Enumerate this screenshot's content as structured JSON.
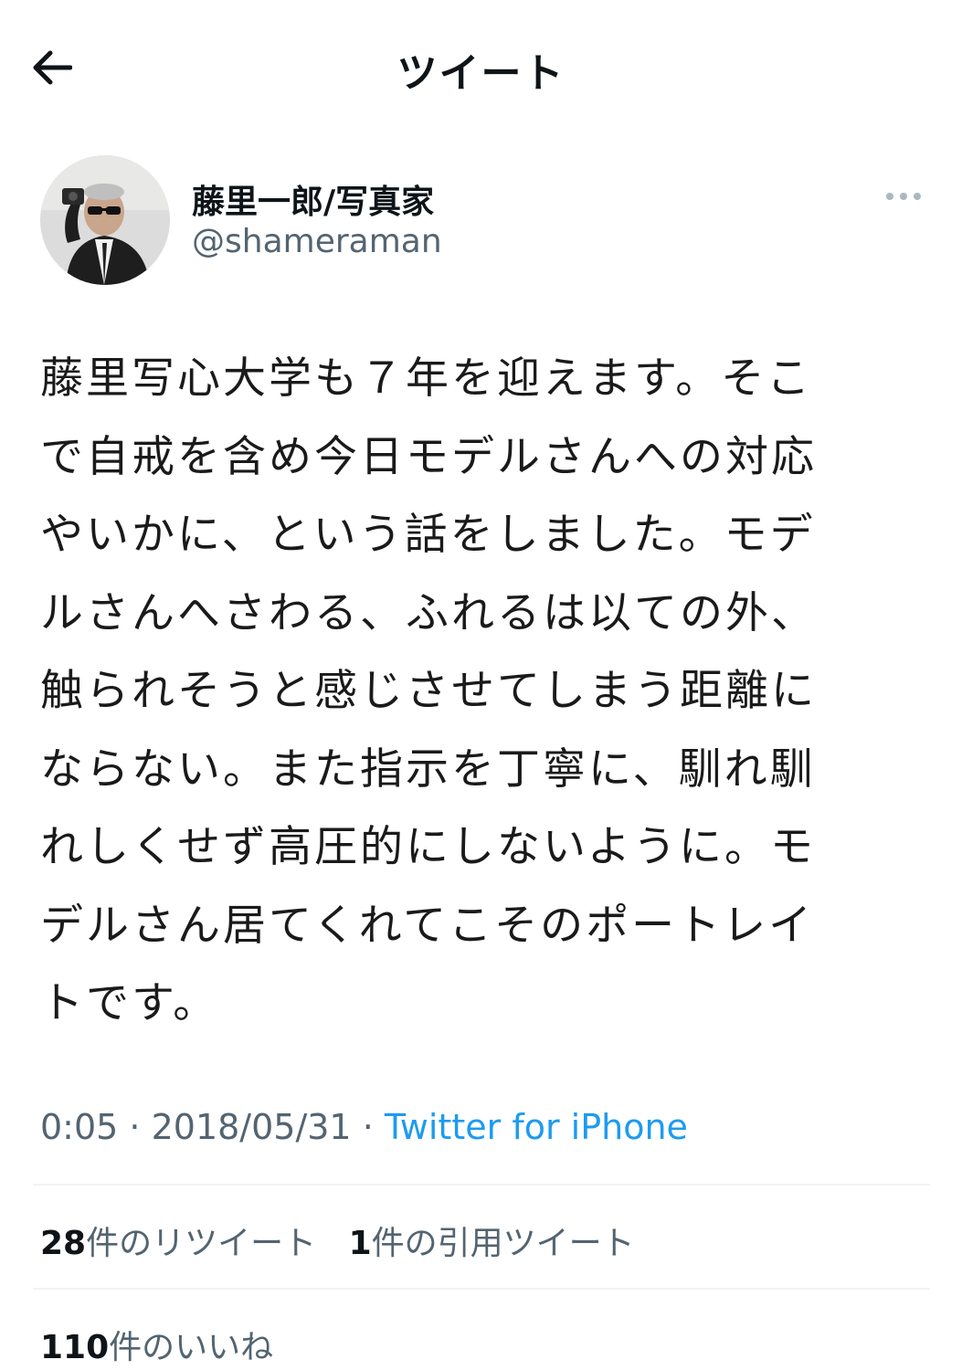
{
  "header": {
    "title": "ツイート",
    "back_icon": "arrow-left-icon"
  },
  "author": {
    "display_name": "藤里一郎/写真家",
    "handle": "@shameraman",
    "more_icon": "more-horizontal-icon"
  },
  "tweet": {
    "lines": [
      "藤里写心大学も７年を迎えます。そこ",
      "で自戒を含め今日モデルさんへの対応",
      "やいかに、という話をしました。モデ",
      "ルさんへさわる、ふれるは以ての外、",
      "触られそうと感じさせてしまう距離に",
      "ならない。また指示を丁寧に、馴れ馴",
      "れしくせず高圧的にしないように。モ",
      "デルさん居てくれてこそのポートレイ",
      "トです。"
    ]
  },
  "meta": {
    "time": "0:05",
    "separator": " · ",
    "date": "2018/05/31",
    "source": "Twitter for iPhone"
  },
  "stats": {
    "retweets": {
      "count": "28",
      "label": "件のリツイート"
    },
    "quotes": {
      "count": "1",
      "label": "件の引用ツイート"
    },
    "likes": {
      "count": "110",
      "label": "件のいいね"
    }
  },
  "colors": {
    "link": "#1d9bf0",
    "secondary_text": "#536471",
    "divider": "#eff3f4"
  }
}
